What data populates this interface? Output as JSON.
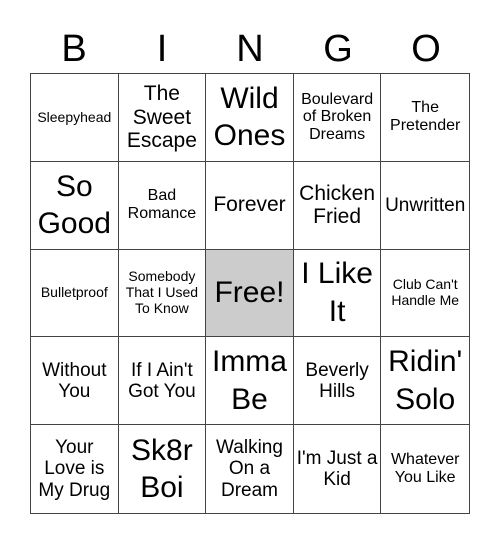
{
  "header": {
    "letters": [
      "B",
      "I",
      "N",
      "G",
      "O"
    ]
  },
  "free_cell_color": "#cccccc",
  "grid": {
    "rows": [
      [
        "Sleepyhead",
        "The Sweet Escape",
        "Wild Ones",
        "Boulevard of Broken Dreams",
        "The Pretender"
      ],
      [
        "So Good",
        "Bad Romance",
        "Forever",
        "Chicken Fried",
        "Unwritten"
      ],
      [
        "Bulletproof",
        "Somebody That I Used To Know",
        "Free!",
        "I Like It",
        "Club Can't Handle Me"
      ],
      [
        "Without You",
        "If I Ain't Got You",
        "Imma Be",
        "Beverly Hills",
        "Ridin' Solo"
      ],
      [
        "Your Love is My Drug",
        "Sk8r Boi",
        "Walking On a Dream",
        "I'm Just a Kid",
        "Whatever You Like"
      ]
    ]
  }
}
